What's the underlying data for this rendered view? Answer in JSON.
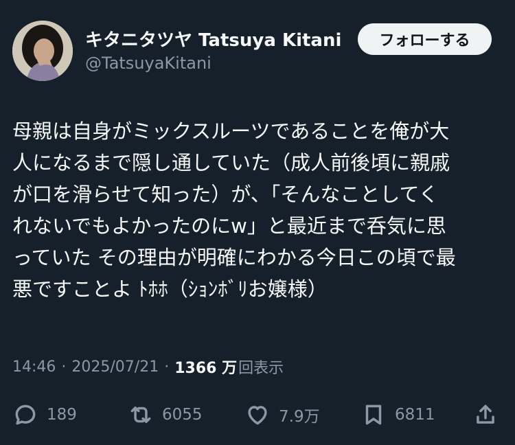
{
  "author": {
    "display_name": "キタニタツヤ Tatsuya Kitani",
    "handle": "@TatsuyaKitani"
  },
  "follow_button": {
    "label": "フォローする"
  },
  "tweet": {
    "lines": [
      "母親は自身がミックスルーツであることを俺が大",
      "人になるまで隠し通していた（成人前後頃に親戚",
      "が口を滑らせて知った）が、「そんなことしてく",
      "れないでもよかったのにw」と最近まで呑気に思",
      "っていた その理由が明確にわかる今日この頃で最",
      "悪ですことよ ﾄﾎﾎ（ｼｮﾝﾎﾞﾘお嬢様）"
    ]
  },
  "meta": {
    "time": "14:46",
    "date": "2025/07/21",
    "separator": "·",
    "views_count": "1366 万",
    "views_label": "回表示"
  },
  "actions": {
    "reply_count": "189",
    "retweet_count": "6055",
    "like_count": "7.9万",
    "bookmark_count": "6811"
  },
  "colors": {
    "background": "#15202b",
    "text_primary": "#f7f9f9",
    "text_secondary": "#8b98a5",
    "follow_button_bg": "#eff3f4"
  },
  "icons": {
    "reply": "reply-icon",
    "retweet": "retweet-icon",
    "like": "heart-icon",
    "bookmark": "bookmark-icon",
    "share": "share-icon"
  }
}
